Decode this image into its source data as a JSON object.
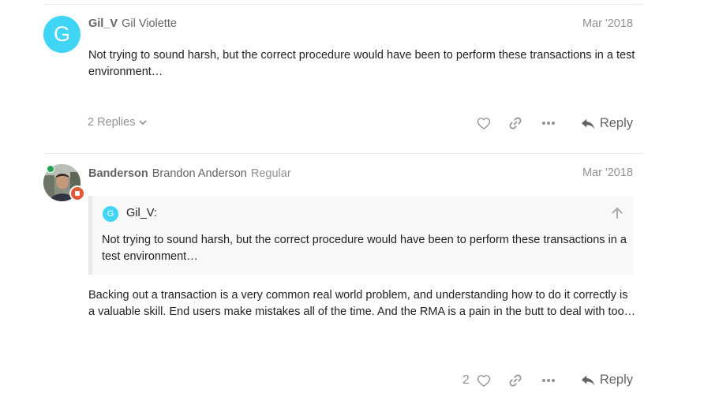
{
  "posts": [
    {
      "username": "Gil_V",
      "full_name": "Gil Violette",
      "user_title": "",
      "avatar_letter": "G",
      "avatar_color": "#40d4f5",
      "date": "Mar '2018",
      "body": "Not trying to sound harsh, but the correct procedure would have been to perform these transactions in a test environment…",
      "replies_label": "2 Replies",
      "like_count": "",
      "reply_label": "Reply"
    },
    {
      "username": "Banderson",
      "full_name": "Brandon Anderson",
      "user_title": "Regular",
      "online": true,
      "date": "Mar '2018",
      "quote": {
        "avatar_letter": "G",
        "username": "Gil_V:",
        "text": "Not trying to sound harsh, but the correct procedure would have been to perform these transactions in a test environment…"
      },
      "body": "Backing out a transaction is a very common real world problem, and understanding how to do it correctly is a valuable skill. End users make mistakes all of the time. And the RMA is a pain in the butt to deal with too…",
      "like_count": "2",
      "reply_label": "Reply"
    }
  ],
  "colors": {
    "avatar_accent": "#40d4f5",
    "online": "#1ca551",
    "flair": "#e45735",
    "muted_text": "#919191"
  }
}
